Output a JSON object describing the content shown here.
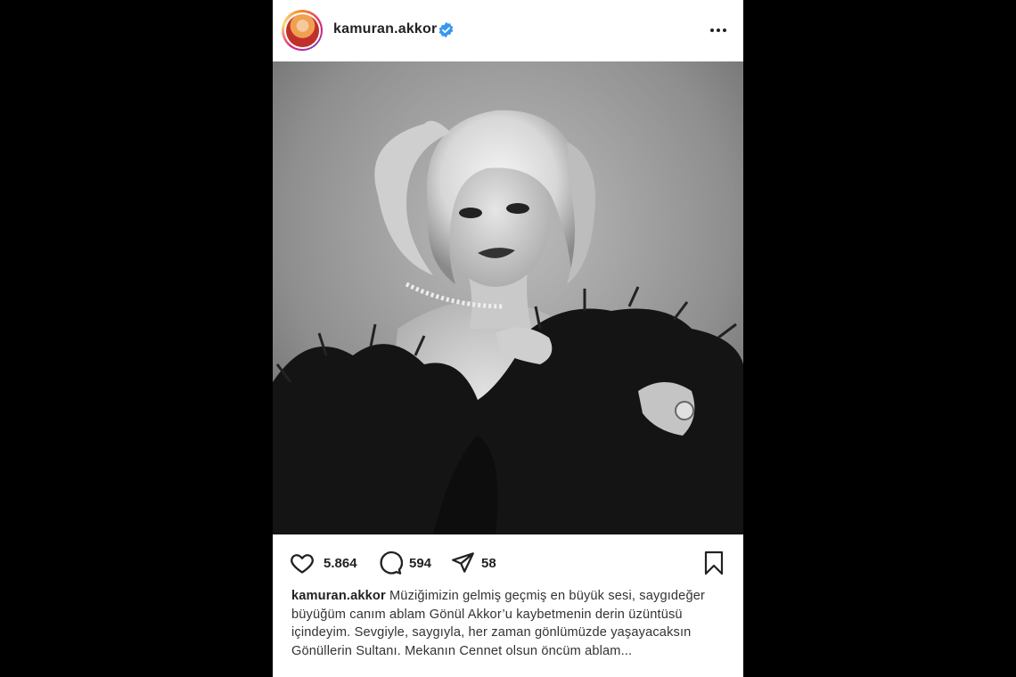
{
  "post": {
    "username": "kamuran.akkor",
    "verified_icon": "verified-badge-icon",
    "more_icon": "more-options-icon",
    "photo_alt": "Black and white portrait",
    "actions": {
      "likes": "5.864",
      "comments": "594",
      "shares": "58"
    },
    "caption": {
      "author": "kamuran.akkor",
      "text": "Müziğimizin gelmiş geçmiş en büyük sesi, saygıdeğer büyüğüm canım ablam Gönül Akkor’u kaybetmenin derin üzüntüsü içindeyim. Sevgiyle, saygıyla, her zaman gönlümüzde yaşayacaksın Gönüllerin Sultanı. Mekanın Cennet olsun öncüm ablam..."
    },
    "colors": {
      "verified": "#3897f0",
      "background": "#000000",
      "card": "#ffffff"
    }
  }
}
